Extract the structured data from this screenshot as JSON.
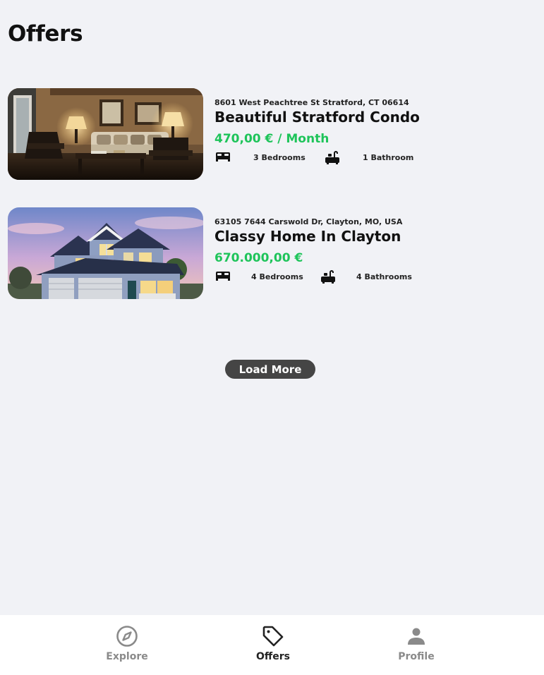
{
  "page": {
    "title": "Offers"
  },
  "listings": [
    {
      "address": "8601 West Peachtree St Stratford, CT 06614",
      "name": "Beautiful Stratford Condo",
      "price": "470,00 € / Month",
      "bedrooms": "3 Bedrooms",
      "bathrooms": "1 Bathroom"
    },
    {
      "address": "63105 7644 Carswold Dr, Clayton, MO, USA",
      "name": "Classy Home In Clayton",
      "price": "670.000,00 €",
      "bedrooms": "4 Bedrooms",
      "bathrooms": "4 Bathrooms"
    }
  ],
  "load_more_label": "Load More",
  "tabs": [
    {
      "label": "Explore",
      "icon": "compass-icon",
      "active": false
    },
    {
      "label": "Offers",
      "icon": "tag-icon",
      "active": true
    },
    {
      "label": "Profile",
      "icon": "person-icon",
      "active": false
    }
  ],
  "colors": {
    "price": "#1ec45a",
    "button": "#454545",
    "background": "#f1f2f6"
  }
}
